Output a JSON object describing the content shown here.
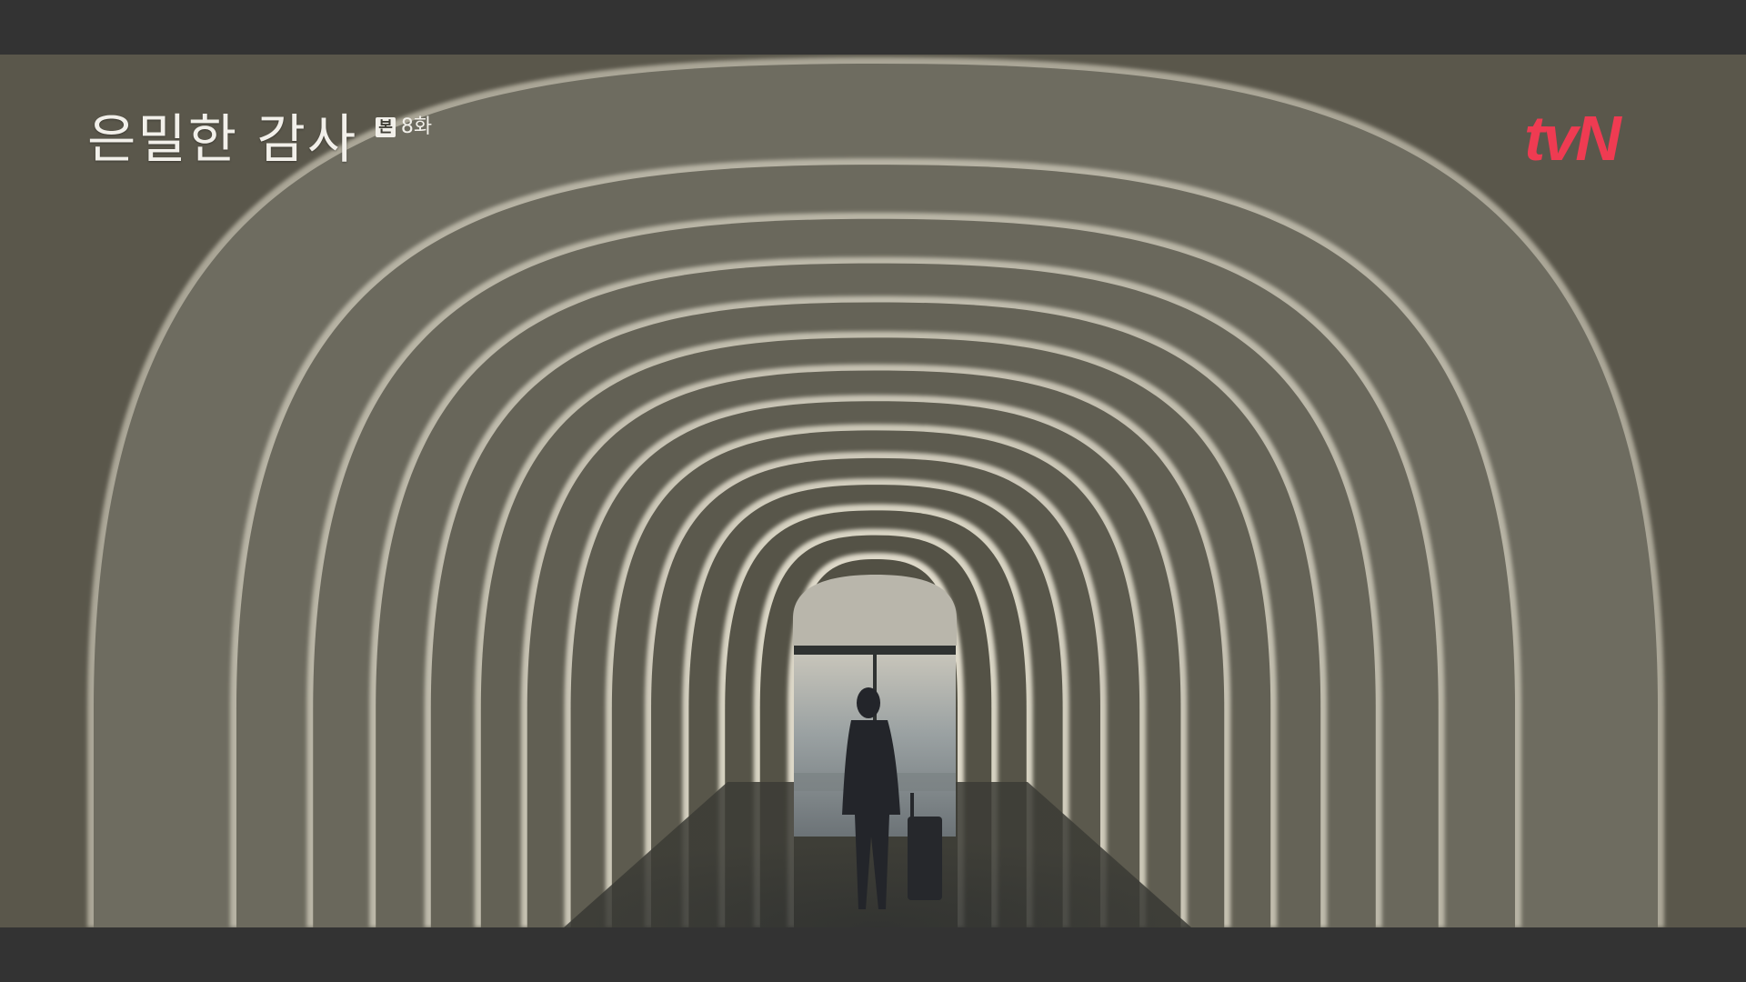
{
  "overlay": {
    "show_title": "은밀한 감사",
    "episode_badge": "본",
    "episode_number": "8화",
    "channel_logo": "tvN"
  },
  "colors": {
    "letterbox": "#333333",
    "wall": "#5d5a4e",
    "arch_light": "#e9e4d6",
    "logo": "#ef3b52",
    "title_text": "#f2f0ea"
  }
}
